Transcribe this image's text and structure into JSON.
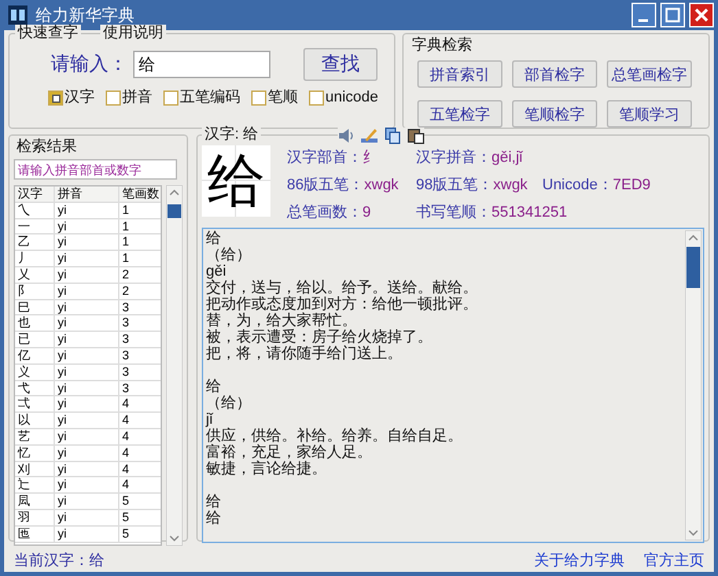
{
  "window": {
    "title": "给力新华字典"
  },
  "quick_search": {
    "title": "快速查字",
    "help_tab": "使用说明",
    "input_label": "请输入：",
    "input_value": "给",
    "search_button": "查找",
    "modes": [
      {
        "label": "汉字",
        "checked": true
      },
      {
        "label": "拼音",
        "checked": false
      },
      {
        "label": "五笔编码",
        "checked": false
      },
      {
        "label": "笔顺",
        "checked": false
      },
      {
        "label": "unicode",
        "checked": false
      }
    ]
  },
  "dictionary_search": {
    "title": "字典检索",
    "buttons": [
      "拼音索引",
      "部首检字",
      "总笔画检字",
      "五笔检字",
      "笔顺检字",
      "笔顺学习"
    ]
  },
  "results": {
    "title": "检索结果",
    "filter_placeholder": "请输入拼音部首或数字",
    "columns": [
      "汉字",
      "拼音",
      "笔画数"
    ],
    "rows": [
      [
        "乀",
        "yi",
        "1"
      ],
      [
        "一",
        "yi",
        "1"
      ],
      [
        "乙",
        "yi",
        "1"
      ],
      [
        "丿",
        "yi",
        "1"
      ],
      [
        "乂",
        "yi",
        "2"
      ],
      [
        "阝",
        "yi",
        "2"
      ],
      [
        "巳",
        "yi",
        "3"
      ],
      [
        "也",
        "yi",
        "3"
      ],
      [
        "已",
        "yi",
        "3"
      ],
      [
        "亿",
        "yi",
        "3"
      ],
      [
        "义",
        "yi",
        "3"
      ],
      [
        "弋",
        "yi",
        "3"
      ],
      [
        "弌",
        "yi",
        "4"
      ],
      [
        "以",
        "yi",
        "4"
      ],
      [
        "艺",
        "yi",
        "4"
      ],
      [
        "忆",
        "yi",
        "4"
      ],
      [
        "刈",
        "yi",
        "4"
      ],
      [
        "辷",
        "yi",
        "4"
      ],
      [
        "凨",
        "yi",
        "5"
      ],
      [
        "羽",
        "yi",
        "5"
      ],
      [
        "匜",
        "yi",
        "5"
      ]
    ]
  },
  "character": {
    "title": "汉字: 给",
    "glyph": "给",
    "fields": [
      {
        "label": "汉字部首：",
        "value": "纟"
      },
      {
        "label": "汉字拼音：",
        "value": "gěi,jǐ"
      },
      {
        "label": "86版五笔：",
        "value": "xwgk"
      },
      {
        "label": "98版五笔：",
        "value": "xwgk"
      },
      {
        "label": "Unicode：",
        "value": "7ED9"
      },
      {
        "label": "总笔画数：",
        "value": "9"
      },
      {
        "label": "书写笔顺：",
        "value": "551341251"
      }
    ],
    "definition": [
      {
        "lines": [
          "给",
          "（给）",
          "gěi",
          "交付，送与，给以。给予。送给。献给。",
          "把动作或态度加到对方：给他一顿批评。",
          "替，为，给大家帮忙。",
          "被，表示遭受：房子给火烧掉了。",
          "把，将，请你随手给门送上。"
        ]
      },
      {
        "lines": [
          "给",
          "（给）",
          "jǐ",
          "供应，供给。补给。给养。自给自足。",
          "富裕，充足，家给人足。",
          "敏捷，言论给捷。"
        ]
      },
      {
        "lines": [
          "给",
          "给"
        ]
      }
    ]
  },
  "status_bar": {
    "current": "当前汉字：给",
    "links": [
      "关于给力字典",
      "官方主页"
    ]
  }
}
